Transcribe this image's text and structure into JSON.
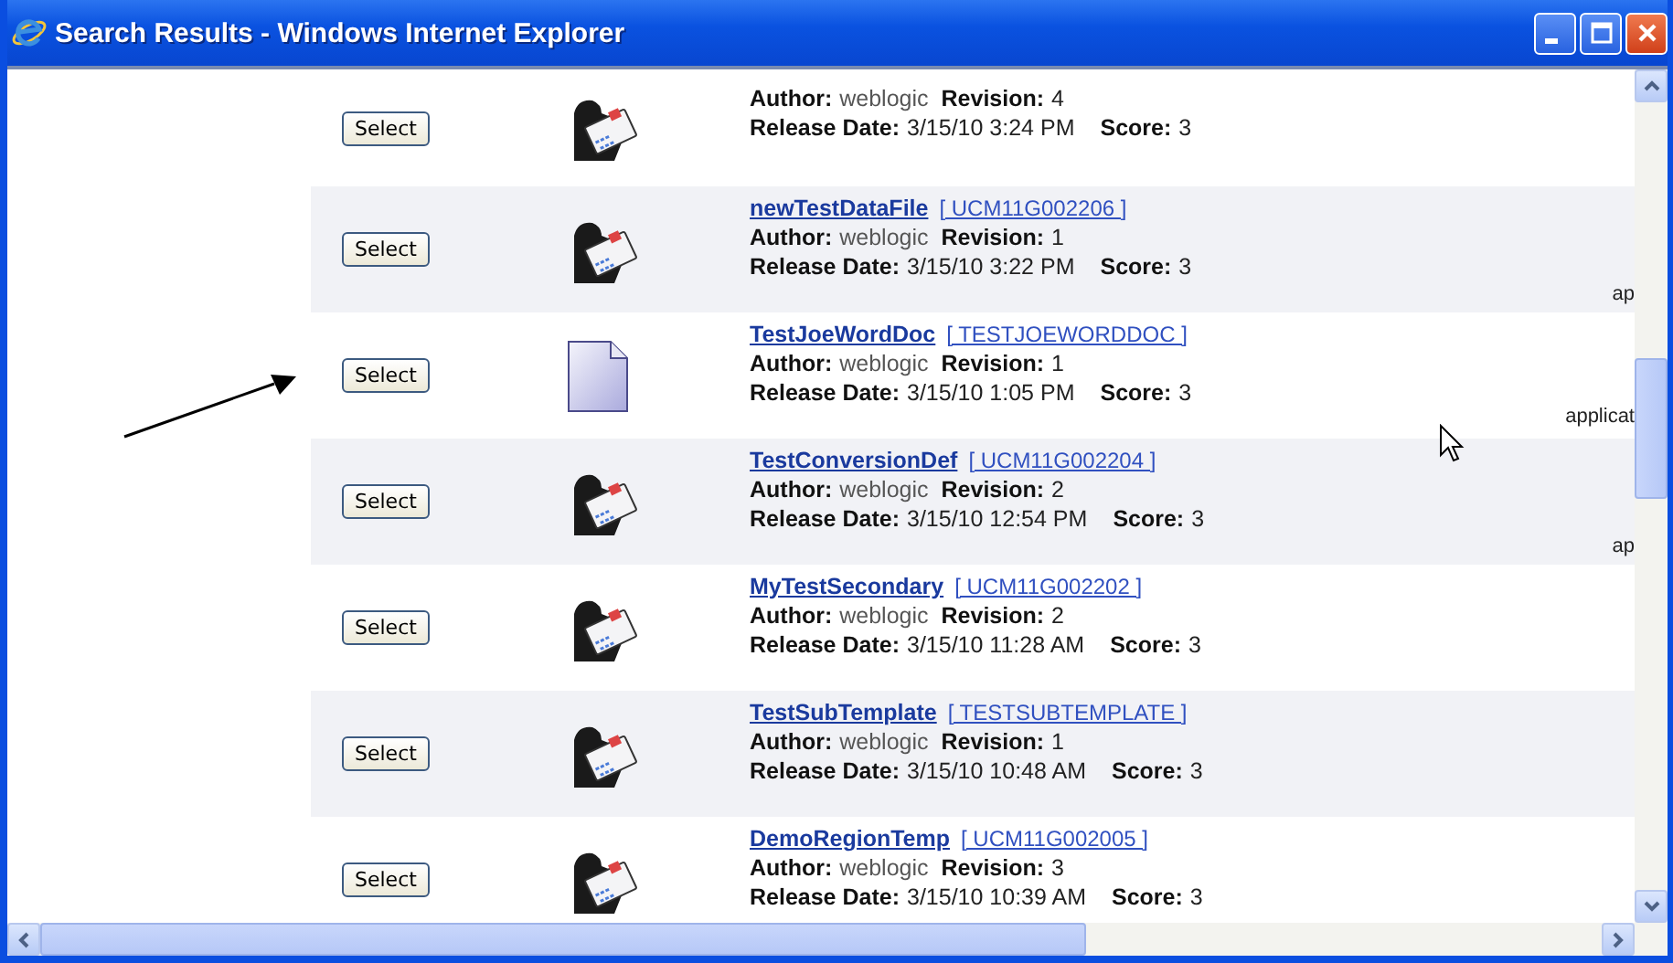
{
  "window": {
    "title": "Search Results - Windows Internet Explorer"
  },
  "results": [
    {
      "kind": "message",
      "author_label": "Author:",
      "author": "weblogic",
      "revision_label": "Revision:",
      "revision": "4",
      "date_label": "Release Date:",
      "date": "3/15/10 3:24 PM",
      "score_label": "Score:",
      "score": "3",
      "button": "Select"
    },
    {
      "kind": "message",
      "title": "newTestDataFile",
      "id": "[ UCM11G002206 ]",
      "author_label": "Author:",
      "author": "weblogic",
      "revision_label": "Revision:",
      "revision": "1",
      "date_label": "Release Date:",
      "date": "3/15/10 3:22 PM",
      "score_label": "Score:",
      "score": "3",
      "button": "Select",
      "side_text": "ap"
    },
    {
      "kind": "document",
      "title": "TestJoeWordDoc",
      "id": "[ TESTJOEWORDDOC ]",
      "author_label": "Author:",
      "author": "weblogic",
      "revision_label": "Revision:",
      "revision": "1",
      "date_label": "Release Date:",
      "date": "3/15/10 1:05 PM",
      "score_label": "Score:",
      "score": "3",
      "button": "Select",
      "side_text": "applicat"
    },
    {
      "kind": "message",
      "title": "TestConversionDef",
      "id": "[ UCM11G002204 ]",
      "author_label": "Author:",
      "author": "weblogic",
      "revision_label": "Revision:",
      "revision": "2",
      "date_label": "Release Date:",
      "date": "3/15/10 12:54 PM",
      "score_label": "Score:",
      "score": "3",
      "button": "Select",
      "side_text": "ap"
    },
    {
      "kind": "message",
      "title": "MyTestSecondary",
      "id": "[ UCM11G002202 ]",
      "author_label": "Author:",
      "author": "weblogic",
      "revision_label": "Revision:",
      "revision": "2",
      "date_label": "Release Date:",
      "date": "3/15/10 11:28 AM",
      "score_label": "Score:",
      "score": "3",
      "button": "Select"
    },
    {
      "kind": "message",
      "title": "TestSubTemplate",
      "id": "[ TESTSUBTEMPLATE ]",
      "author_label": "Author:",
      "author": "weblogic",
      "revision_label": "Revision:",
      "revision": "1",
      "date_label": "Release Date:",
      "date": "3/15/10 10:48 AM",
      "score_label": "Score:",
      "score": "3",
      "button": "Select"
    },
    {
      "kind": "message",
      "title": "DemoRegionTemp",
      "id": "[ UCM11G002005 ]",
      "author_label": "Author:",
      "author": "weblogic",
      "revision_label": "Revision:",
      "revision": "3",
      "date_label": "Release Date:",
      "date": "3/15/10 10:39 AM",
      "score_label": "Score:",
      "score": "3",
      "button": "Select"
    }
  ]
}
